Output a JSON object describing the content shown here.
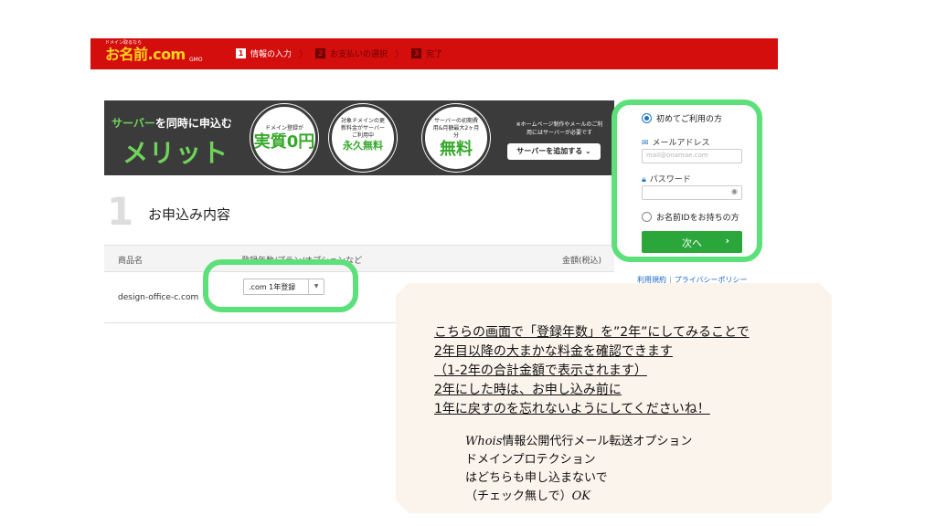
{
  "header": {
    "logo_tagline": "ドメイン取るなら",
    "logo_main": "お名前.com",
    "logo_sub": "GMO",
    "steps": [
      {
        "num": "1",
        "label": "情報の入力"
      },
      {
        "num": "2",
        "label": "お支払いの選択"
      },
      {
        "num": "3",
        "label": "完了"
      }
    ]
  },
  "banner": {
    "lead_green": "サーバー",
    "lead_white": "を同時に申込む",
    "headline": "メリット",
    "badges": [
      {
        "small": "ドメイン登録が",
        "big": "実質0円"
      },
      {
        "small": "対象ドメインの更新料金がサーバーご利用中",
        "big": "永久無料"
      },
      {
        "small": "サーバーの初期費用&月額最大2ヶ月分",
        "big": "無料"
      }
    ],
    "note": "※ホームページ制作やメールのご利用にはサーバーが必要です",
    "add_button": "サーバーを追加する"
  },
  "section": {
    "number": "1",
    "title": "お申込み内容"
  },
  "table": {
    "headers": [
      "商品名",
      "登録年数/プラン/オプションなど",
      "金額(税込)"
    ],
    "rows": [
      {
        "product": "design-office-c.com",
        "selected_period": ".com 1年登録"
      }
    ]
  },
  "login": {
    "first_time": "初めてご利用の方",
    "email_label": "メールアドレス",
    "email_placeholder": "mail@onamae.com",
    "password_label": "パスワード",
    "has_id": "お名前IDをお持ちの方",
    "next_button": "次へ",
    "links": [
      "利用規約",
      "プライバシーポリシー"
    ]
  },
  "annotation": {
    "lines": [
      "こちらの画面で「登録年数」を”2年”にしてみることで",
      "2年目以降の大まかな料金を確認できます",
      "（1-2年の合計金額で表示されます）",
      "2年にした時は、お申し込み前に",
      "1年に戻すのを忘れないようにしてくださいね！"
    ],
    "sub_whois": "Whois",
    "sub_line1_rest": "情報公開代行メール転送オプション",
    "sub_line2": "ドメインプロテクション",
    "sub_line3": "はどちらも申し込まないで",
    "sub_line4_pre": "（チェック無しで）",
    "sub_line4_ok": "OK"
  },
  "colors": {
    "header_red": "#d40d0d",
    "highlight_green": "#5ce07a",
    "button_green": "#2aa63a",
    "banner_dark": "#3b3b3b",
    "note_bg": "#fbf4ec"
  }
}
